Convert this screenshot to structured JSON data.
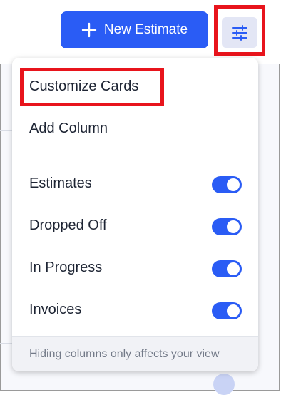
{
  "header": {
    "new_estimate_label": "New Estimate",
    "filter_icon": "sliders-icon"
  },
  "menu": {
    "actions": [
      {
        "label": "Customize Cards"
      },
      {
        "label": "Add Column"
      }
    ],
    "columns": [
      {
        "label": "Estimates",
        "enabled": true
      },
      {
        "label": "Dropped Off",
        "enabled": true
      },
      {
        "label": "In Progress",
        "enabled": true
      },
      {
        "label": "Invoices",
        "enabled": true
      }
    ],
    "footer_note": "Hiding columns only affects your view"
  },
  "colors": {
    "accent": "#2a5cf5",
    "highlight": "#e8141c",
    "filter_button_bg": "#e3e6f5"
  }
}
